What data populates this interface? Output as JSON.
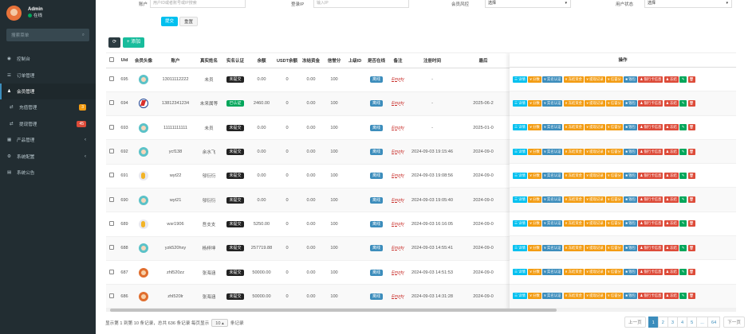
{
  "sidebar": {
    "user": {
      "name": "Admin",
      "status": "在线"
    },
    "search_placeholder": "搜索菜单",
    "items": [
      {
        "label": "控制台",
        "icon": "dashboard-icon",
        "active": false,
        "sub": false
      },
      {
        "label": "订单管理",
        "icon": "list-icon",
        "active": false,
        "sub": false
      },
      {
        "label": "会员管理",
        "icon": "users-icon",
        "active": true,
        "sub": false
      },
      {
        "label": "充值管理",
        "icon": "recharge-icon",
        "active": false,
        "sub": true,
        "badge": "3",
        "badge_color": "#f39c12"
      },
      {
        "label": "提现管理",
        "icon": "withdraw-icon",
        "active": false,
        "sub": true,
        "badge": "45",
        "badge_color": "#dd4b39"
      },
      {
        "label": "产品管理",
        "icon": "product-icon",
        "active": false,
        "sub": false,
        "chevron": true
      },
      {
        "label": "系统配置",
        "icon": "gear-icon",
        "active": false,
        "sub": false,
        "chevron": true
      },
      {
        "label": "系统公告",
        "icon": "announcement-icon",
        "active": false,
        "sub": false
      }
    ]
  },
  "filters": {
    "account_label": "账户",
    "account_placeholder": "用户ID或者账号或IP搜索",
    "ip_label": "登录IP",
    "ip_placeholder": "输入IP",
    "risk_label": "会员风控",
    "risk_value": "选择",
    "state_label": "用户状态",
    "state_value": "选择",
    "submit": "提交",
    "reset": "重置"
  },
  "toolbar": {
    "add": "+ 添加"
  },
  "columns": {
    "uid": "Uid",
    "avatar": "会员头像",
    "account": "账户",
    "real": "真实姓名",
    "verify": "实名认证",
    "balance": "余额",
    "usdt": "USDT余额",
    "frozen": "冻结资金",
    "credit": "信誉分",
    "parent": "上级ID",
    "online": "是否在线",
    "remark": "备注",
    "reg": "注册时间",
    "last": "最后",
    "ops": "操作"
  },
  "rows": [
    {
      "uid": "695",
      "face": "a",
      "account": "13011112222",
      "real": "未员",
      "verify": "未提交",
      "vc": "dark",
      "balance": "0.00",
      "usdt": "0",
      "frozen": "0.00",
      "credit": "100",
      "parent": "",
      "online": "离线",
      "remark": "Empty",
      "reg": "-",
      "last": ""
    },
    {
      "uid": "694",
      "face": "b",
      "account": "13812341234",
      "real": "未来属等",
      "verify": "已认证",
      "vc": "green",
      "balance": "2460.00",
      "usdt": "0",
      "frozen": "0.00",
      "credit": "100",
      "parent": "",
      "online": "离线",
      "remark": "Empty",
      "reg": "-",
      "last": "2025-06-2"
    },
    {
      "uid": "693",
      "face": "a",
      "account": "11111111111",
      "real": "未员",
      "verify": "未提交",
      "vc": "dark",
      "balance": "0.00",
      "usdt": "0",
      "frozen": "0.00",
      "credit": "100",
      "parent": "",
      "online": "离线",
      "remark": "Empty",
      "reg": "-",
      "last": "2025-01-0"
    },
    {
      "uid": "692",
      "face": "a",
      "account": "ycf138",
      "real": "余水飞",
      "verify": "未提交",
      "vc": "dark",
      "balance": "0.00",
      "usdt": "0",
      "frozen": "0.00",
      "credit": "100",
      "parent": "",
      "online": "离线",
      "remark": "Empty",
      "reg": "2024-09-03 19:15:46",
      "last": "2024-09-0"
    },
    {
      "uid": "691",
      "face": "c",
      "account": "wyt22",
      "real": "邬衍衍",
      "verify": "未提交",
      "vc": "dark",
      "balance": "0.00",
      "usdt": "0",
      "frozen": "0.00",
      "credit": "100",
      "parent": "",
      "online": "离线",
      "remark": "Empty",
      "reg": "2024-09-03 19:08:56",
      "last": "2024-09-0"
    },
    {
      "uid": "690",
      "face": "a",
      "account": "wyt21",
      "real": "邬衍衍",
      "verify": "未提交",
      "vc": "dark",
      "balance": "0.00",
      "usdt": "0",
      "frozen": "0.00",
      "credit": "100",
      "parent": "",
      "online": "离线",
      "remark": "Empty",
      "reg": "2024-09-03 19:05:40",
      "last": "2024-09-0"
    },
    {
      "uid": "689",
      "face": "c",
      "account": "wsr1906",
      "real": "吾支支",
      "verify": "未提交",
      "vc": "dark",
      "balance": "5250.00",
      "usdt": "0",
      "frozen": "0.00",
      "credit": "100",
      "parent": "",
      "online": "离线",
      "remark": "Empty",
      "reg": "2024-09-03 16:16:05",
      "last": "2024-09-0"
    },
    {
      "uid": "688",
      "face": "a",
      "account": "yzk520hxy",
      "real": "杨梓坤",
      "verify": "未提交",
      "vc": "dark",
      "balance": "257719.88",
      "usdt": "0",
      "frozen": "0.00",
      "credit": "100",
      "parent": "",
      "online": "离线",
      "remark": "Empty",
      "reg": "2024-09-03 14:55:41",
      "last": "2024-09-0"
    },
    {
      "uid": "687",
      "face": "d",
      "account": "zhl520zz",
      "real": "张海涵",
      "verify": "未提交",
      "vc": "dark",
      "balance": "50000.00",
      "usdt": "0",
      "frozen": "0.00",
      "credit": "100",
      "parent": "",
      "online": "离线",
      "remark": "Empty",
      "reg": "2024-09-03 14:51:53",
      "last": "2024-09-0"
    },
    {
      "uid": "686",
      "face": "d",
      "account": "zhl520lr",
      "real": "张海涵",
      "verify": "未提交",
      "vc": "dark",
      "balance": "50000.00",
      "usdt": "0",
      "frozen": "0.00",
      "credit": "100",
      "parent": "",
      "online": "离线",
      "remark": "Empty",
      "reg": "2024-09-03 14:31:28",
      "last": "2024-09-0"
    }
  ],
  "ops_buttons": [
    {
      "label": "☰ 详情",
      "color": "#00c0ef"
    },
    {
      "label": "¥ 分数",
      "color": "#f39c12"
    },
    {
      "label": "¥ 实名认证",
      "color": "#3c8dbc"
    },
    {
      "label": "¥ 冻结资金",
      "color": "#f39c12"
    },
    {
      "label": "¥ 提现记录",
      "color": "#f39c12"
    },
    {
      "label": "¥ 信誉分",
      "color": "#f39c12"
    },
    {
      "label": "■ 钱包",
      "color": "#3c8dbc"
    },
    {
      "label": "♟ 银行卡信息",
      "color": "#dd4b39"
    },
    {
      "label": "♟ 冻结",
      "color": "#dd4b39"
    },
    {
      "label": "✎",
      "color": "#00a65a",
      "square": true
    },
    {
      "label": "🗑",
      "color": "#dd4b39",
      "square": true
    }
  ],
  "footer": {
    "text1": "显示第 1 到第 10 条记录，总共 636 条记录 每页显示",
    "size": "10 ▴",
    "text2": "条记录"
  },
  "pagination": [
    "上一页",
    "1",
    "2",
    "3",
    "4",
    "5",
    "...",
    "64",
    "下一页"
  ]
}
